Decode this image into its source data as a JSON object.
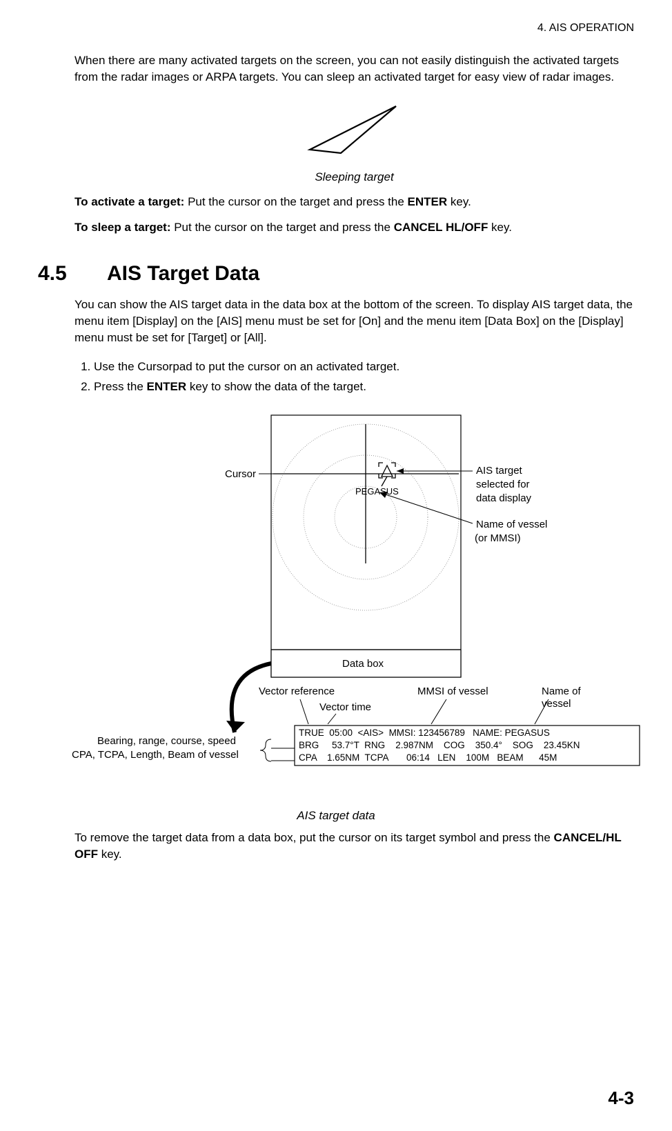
{
  "header": "4.  AIS OPERATION",
  "intro": "When there are many activated targets on the screen, you can not easily distinguish the activated targets from the radar images or ARPA targets. You can sleep an activated target for easy view of radar images.",
  "sleeping_caption": "Sleeping target",
  "activate_label": "To activate a target:",
  "activate_text": " Put the cursor on the target and press the ",
  "activate_key": "ENTER",
  "activate_tail": " key.",
  "sleep_label": "To sleep a target:",
  "sleep_text": " Put the cursor on the target and press the ",
  "sleep_key": "CANCEL HL/OFF",
  "sleep_tail": " key.",
  "section_num": "4.5",
  "section_title": "AIS Target Data",
  "section_para": "You can show the AIS target data in the data box at the bottom of the screen. To display AIS target data, the menu item [Display] on the [AIS] menu must be set for [On] and the menu item [Data Box] on the [Display] menu must be set for [Target] or [All].",
  "step1": "Use the Cursorpad to put the cursor on an activated target.",
  "step2_a": "Press the ",
  "step2_key": "ENTER",
  "step2_b": " key to show the data of the target.",
  "labels": {
    "cursor": "Cursor",
    "pegasus": "PEGASUS",
    "ais_sel_l1": "AIS target",
    "ais_sel_l2": "selected for",
    "ais_sel_l3": "data display",
    "name_l1": "Name of vessel",
    "name_l2": " (or MMSI)",
    "databox": "Data box",
    "vecref": "Vector reference",
    "vectime": "Vector time",
    "mmsi": "MMSI of vessel",
    "nameof_l1": "Name of",
    "nameof_l2": "vessel",
    "left_l1": "Bearing, range, course, speed",
    "left_l2": "CPA, TCPA, Length, Beam of vessel"
  },
  "databox": {
    "l1": "TRUE  05:00  <AIS>  MMSI: 123456789   NAME: PEGASUS",
    "l2": "BRG     53.7°T  RNG    2.987NM    COG    350.4°    SOG    23.45KN",
    "l3": "CPA    1.65NM  TCPA       06:14   LEN    100M   BEAM      45M"
  },
  "fig2_caption": "AIS target data",
  "outro_a": "To remove the target data from a data box, put the cursor on its target symbol and press the ",
  "outro_key": "CANCEL/HL OFF",
  "outro_b": " key.",
  "footer": "4-3"
}
